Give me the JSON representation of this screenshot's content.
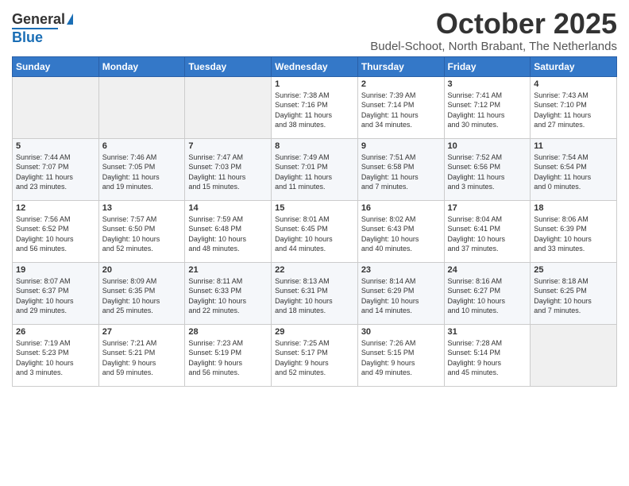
{
  "logo": {
    "general": "General",
    "blue": "Blue"
  },
  "title": "October 2025",
  "location": "Budel-Schoot, North Brabant, The Netherlands",
  "days_of_week": [
    "Sunday",
    "Monday",
    "Tuesday",
    "Wednesday",
    "Thursday",
    "Friday",
    "Saturday"
  ],
  "weeks": [
    [
      {
        "day": "",
        "info": ""
      },
      {
        "day": "",
        "info": ""
      },
      {
        "day": "",
        "info": ""
      },
      {
        "day": "1",
        "info": "Sunrise: 7:38 AM\nSunset: 7:16 PM\nDaylight: 11 hours\nand 38 minutes."
      },
      {
        "day": "2",
        "info": "Sunrise: 7:39 AM\nSunset: 7:14 PM\nDaylight: 11 hours\nand 34 minutes."
      },
      {
        "day": "3",
        "info": "Sunrise: 7:41 AM\nSunset: 7:12 PM\nDaylight: 11 hours\nand 30 minutes."
      },
      {
        "day": "4",
        "info": "Sunrise: 7:43 AM\nSunset: 7:10 PM\nDaylight: 11 hours\nand 27 minutes."
      }
    ],
    [
      {
        "day": "5",
        "info": "Sunrise: 7:44 AM\nSunset: 7:07 PM\nDaylight: 11 hours\nand 23 minutes."
      },
      {
        "day": "6",
        "info": "Sunrise: 7:46 AM\nSunset: 7:05 PM\nDaylight: 11 hours\nand 19 minutes."
      },
      {
        "day": "7",
        "info": "Sunrise: 7:47 AM\nSunset: 7:03 PM\nDaylight: 11 hours\nand 15 minutes."
      },
      {
        "day": "8",
        "info": "Sunrise: 7:49 AM\nSunset: 7:01 PM\nDaylight: 11 hours\nand 11 minutes."
      },
      {
        "day": "9",
        "info": "Sunrise: 7:51 AM\nSunset: 6:58 PM\nDaylight: 11 hours\nand 7 minutes."
      },
      {
        "day": "10",
        "info": "Sunrise: 7:52 AM\nSunset: 6:56 PM\nDaylight: 11 hours\nand 3 minutes."
      },
      {
        "day": "11",
        "info": "Sunrise: 7:54 AM\nSunset: 6:54 PM\nDaylight: 11 hours\nand 0 minutes."
      }
    ],
    [
      {
        "day": "12",
        "info": "Sunrise: 7:56 AM\nSunset: 6:52 PM\nDaylight: 10 hours\nand 56 minutes."
      },
      {
        "day": "13",
        "info": "Sunrise: 7:57 AM\nSunset: 6:50 PM\nDaylight: 10 hours\nand 52 minutes."
      },
      {
        "day": "14",
        "info": "Sunrise: 7:59 AM\nSunset: 6:48 PM\nDaylight: 10 hours\nand 48 minutes."
      },
      {
        "day": "15",
        "info": "Sunrise: 8:01 AM\nSunset: 6:45 PM\nDaylight: 10 hours\nand 44 minutes."
      },
      {
        "day": "16",
        "info": "Sunrise: 8:02 AM\nSunset: 6:43 PM\nDaylight: 10 hours\nand 40 minutes."
      },
      {
        "day": "17",
        "info": "Sunrise: 8:04 AM\nSunset: 6:41 PM\nDaylight: 10 hours\nand 37 minutes."
      },
      {
        "day": "18",
        "info": "Sunrise: 8:06 AM\nSunset: 6:39 PM\nDaylight: 10 hours\nand 33 minutes."
      }
    ],
    [
      {
        "day": "19",
        "info": "Sunrise: 8:07 AM\nSunset: 6:37 PM\nDaylight: 10 hours\nand 29 minutes."
      },
      {
        "day": "20",
        "info": "Sunrise: 8:09 AM\nSunset: 6:35 PM\nDaylight: 10 hours\nand 25 minutes."
      },
      {
        "day": "21",
        "info": "Sunrise: 8:11 AM\nSunset: 6:33 PM\nDaylight: 10 hours\nand 22 minutes."
      },
      {
        "day": "22",
        "info": "Sunrise: 8:13 AM\nSunset: 6:31 PM\nDaylight: 10 hours\nand 18 minutes."
      },
      {
        "day": "23",
        "info": "Sunrise: 8:14 AM\nSunset: 6:29 PM\nDaylight: 10 hours\nand 14 minutes."
      },
      {
        "day": "24",
        "info": "Sunrise: 8:16 AM\nSunset: 6:27 PM\nDaylight: 10 hours\nand 10 minutes."
      },
      {
        "day": "25",
        "info": "Sunrise: 8:18 AM\nSunset: 6:25 PM\nDaylight: 10 hours\nand 7 minutes."
      }
    ],
    [
      {
        "day": "26",
        "info": "Sunrise: 7:19 AM\nSunset: 5:23 PM\nDaylight: 10 hours\nand 3 minutes."
      },
      {
        "day": "27",
        "info": "Sunrise: 7:21 AM\nSunset: 5:21 PM\nDaylight: 9 hours\nand 59 minutes."
      },
      {
        "day": "28",
        "info": "Sunrise: 7:23 AM\nSunset: 5:19 PM\nDaylight: 9 hours\nand 56 minutes."
      },
      {
        "day": "29",
        "info": "Sunrise: 7:25 AM\nSunset: 5:17 PM\nDaylight: 9 hours\nand 52 minutes."
      },
      {
        "day": "30",
        "info": "Sunrise: 7:26 AM\nSunset: 5:15 PM\nDaylight: 9 hours\nand 49 minutes."
      },
      {
        "day": "31",
        "info": "Sunrise: 7:28 AM\nSunset: 5:14 PM\nDaylight: 9 hours\nand 45 minutes."
      },
      {
        "day": "",
        "info": ""
      }
    ]
  ]
}
